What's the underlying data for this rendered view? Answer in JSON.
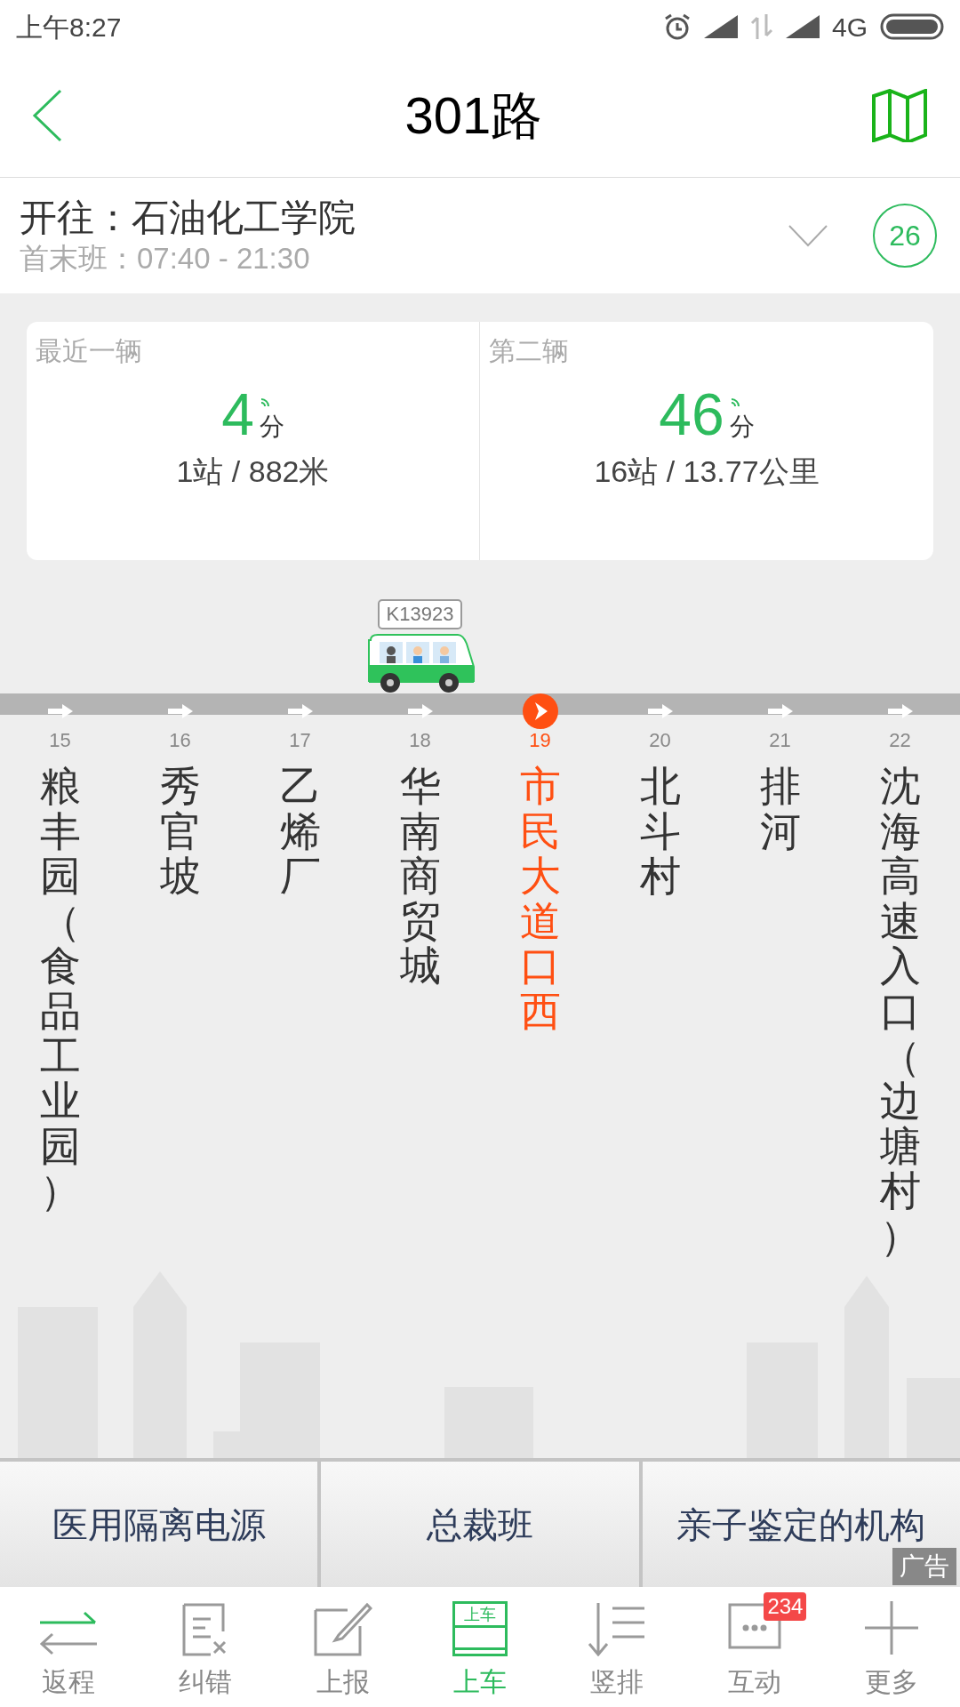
{
  "status_bar": {
    "time": "上午8:27",
    "network": "4G"
  },
  "header": {
    "title": "301路"
  },
  "direction": {
    "destination": "开往：石油化工学院",
    "schedule": "首末班：07:40 - 21:30",
    "countdown": "26"
  },
  "arrivals": [
    {
      "label": "最近一辆",
      "minutes": "4",
      "unit": "分",
      "distance": "1站 / 882米"
    },
    {
      "label": "第二辆",
      "minutes": "46",
      "unit": "分",
      "distance": "16站 / 13.77公里"
    }
  ],
  "stations": [
    {
      "number": "15",
      "name": "粮丰园（食品工业园）",
      "selected": false
    },
    {
      "number": "16",
      "name": "秀官坡",
      "selected": false
    },
    {
      "number": "17",
      "name": "乙烯厂",
      "selected": false
    },
    {
      "number": "18",
      "name": "华南商贸城",
      "selected": false,
      "bus_plate": "K13923"
    },
    {
      "number": "19",
      "name": "市民大道口西",
      "selected": true
    },
    {
      "number": "20",
      "name": "北斗村",
      "selected": false
    },
    {
      "number": "21",
      "name": "排河",
      "selected": false
    },
    {
      "number": "22",
      "name": "沈海高速入口（边塘村）",
      "selected": false
    }
  ],
  "ads": {
    "items": [
      "医用隔离电源",
      "总裁班",
      "亲子鉴定的机构"
    ],
    "tag": "广告"
  },
  "tab_bar": [
    {
      "kind": "swap",
      "label": "返程",
      "selected": false
    },
    {
      "kind": "correct",
      "label": "纠错",
      "selected": false
    },
    {
      "kind": "report",
      "label": "上报",
      "selected": false
    },
    {
      "kind": "board",
      "label": "上车",
      "selected": true,
      "icon_text": "上车"
    },
    {
      "kind": "vertical",
      "label": "竖排",
      "selected": false
    },
    {
      "kind": "chat",
      "label": "互动",
      "selected": false,
      "badge": "234"
    },
    {
      "kind": "more",
      "label": "更多",
      "selected": false
    }
  ]
}
